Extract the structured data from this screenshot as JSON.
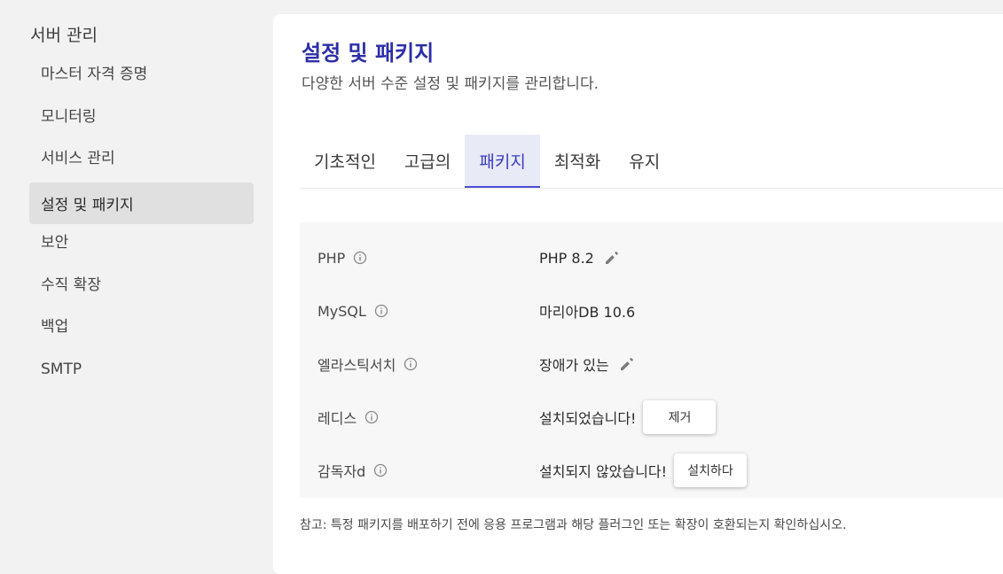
{
  "sidebar": {
    "title": "서버 관리",
    "items": [
      {
        "label": "마스터 자격 증명"
      },
      {
        "label": "모니터링"
      },
      {
        "label": "서비스 관리"
      },
      {
        "label": "설정 및 패키지"
      },
      {
        "label": "보안"
      },
      {
        "label": "수직 확장"
      },
      {
        "label": "백업"
      },
      {
        "label": "SMTP"
      }
    ],
    "active_index": 3
  },
  "main": {
    "title": "설정 및 패키지",
    "subtitle": "다양한 서버 수준 설정 및 패키지를 관리합니다.",
    "tabs": [
      {
        "label": "기초적인"
      },
      {
        "label": "고급의"
      },
      {
        "label": "패키지"
      },
      {
        "label": "최적화"
      },
      {
        "label": "유지"
      }
    ],
    "active_tab": 2,
    "packages": [
      {
        "label": "PHP",
        "value": "PHP 8.2",
        "editable": true,
        "action": null
      },
      {
        "label": "MySQL",
        "value": "마리아DB 10.6",
        "editable": false,
        "action": null
      },
      {
        "label": "엘라스틱서치",
        "value": "장애가 있는",
        "editable": true,
        "action": null
      },
      {
        "label": "레디스",
        "value": "설치되었습니다!",
        "editable": false,
        "action": "제거"
      },
      {
        "label": "감독자d",
        "value": "설치되지 않았습니다!",
        "editable": false,
        "action": "설치하다"
      }
    ],
    "footnote": "참고: 특정 패키지를 배포하기 전에 응용 프로그램과 해당 플러그인 또는 확장이 호환되는지 확인하십시오."
  },
  "colors": {
    "accent": "#2d2fa8",
    "tab_active_bg": "#e8eaf6",
    "tab_active_underline": "#4c4fd6",
    "sidebar_active_bg": "#e0e0e0"
  },
  "icons": {
    "info": "info-circle-icon",
    "edit": "pencil-icon"
  }
}
